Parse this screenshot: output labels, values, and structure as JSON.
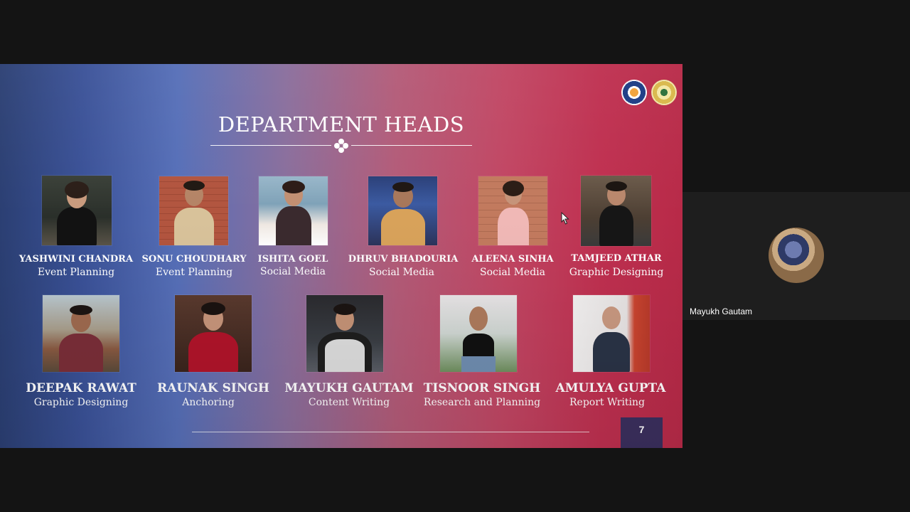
{
  "meeting": {
    "participant": {
      "name": "Mayukh Gautam"
    }
  },
  "slide": {
    "title": "DEPARTMENT HEADS",
    "page_number": "7",
    "colors": {
      "left": "#2b3f73",
      "mid": "#8a6e9c",
      "right": "#b82a48",
      "page_box": "#3b2f5e"
    },
    "team": [
      {
        "name": "YASHWINI CHANDRA",
        "role": "Event Planning"
      },
      {
        "name": "SONU CHOUDHARY",
        "role": "Event Planning"
      },
      {
        "name": "ISHITA GOEL",
        "role": "Social Media"
      },
      {
        "name": "DHRUV BHADOURIA",
        "role": "Social Media"
      },
      {
        "name": "ALEENA SINHA",
        "role": "Social Media"
      },
      {
        "name": "TAMJEED ATHAR",
        "role": "Graphic Designing"
      },
      {
        "name": "DEEPAK RAWAT",
        "role": "Graphic Designing"
      },
      {
        "name": "RAUNAK SINGH",
        "role": "Anchoring"
      },
      {
        "name": "MAYUKH GAUTAM",
        "role": "Content Writing"
      },
      {
        "name": "TISNOOR SINGH",
        "role": "Research and Planning"
      },
      {
        "name": "AMULYA GUPTA",
        "role": "Report Writing"
      }
    ]
  }
}
